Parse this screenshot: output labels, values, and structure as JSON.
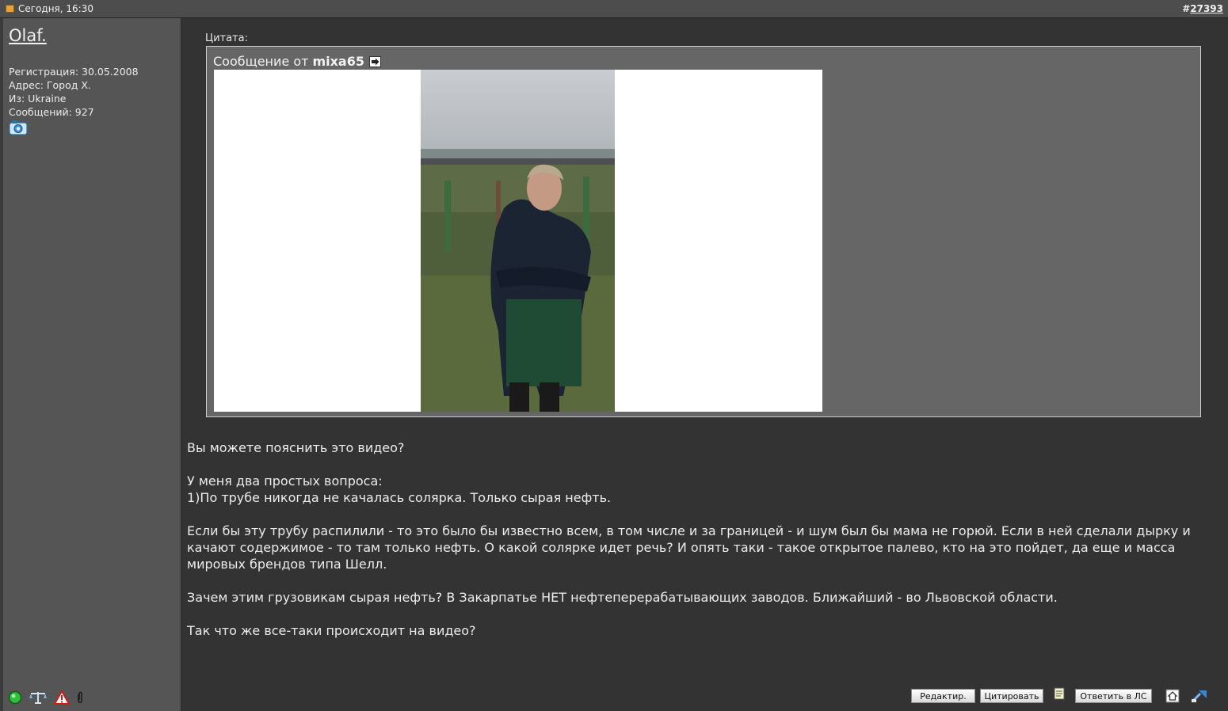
{
  "header": {
    "date": "Сегодня, 16:30",
    "post_hash": "#",
    "post_number": "27393"
  },
  "user": {
    "name": "Olaf.",
    "registration": "Регистрация: 30.05.2008",
    "address": "Адрес: Город Х.",
    "from": "Из: Ukraine",
    "posts": "Сообщений: 927"
  },
  "quote": {
    "label": "Цитата:",
    "prefix": "Сообщение от",
    "author": "mixa65"
  },
  "post": {
    "paragraphs": [
      "Вы можете пояснить это видео?",
      "У меня два простых вопроса:\n1)По трубе никогда не качалась солярка. Только сырая нефть.",
      "Если бы эту трубу распилили - то это было бы известно всем, в том числе и за границей - и шум был бы мама не горюй. Если в ней сделали дырку и качают содержимое - то там только нефть. О какой солярке идет речь? И опять таки - такое открытое палево, кто на это пойдет, да еще и масса мировых брендов типа Шелл.",
      "Зачем этим грузовикам сырая нефть? В Закарпатье НЕТ нефтеперерабатывающих заводов. Ближайший - во Львовской области.",
      "Так что же все-таки происходит на видео?"
    ]
  },
  "actions": {
    "edit": "Редактир.",
    "quote": "Цитировать",
    "reply_pm": "Ответить в ЛС"
  },
  "icons": {
    "status": [
      "online-icon",
      "scales-icon",
      "warning-icon",
      "paperclip-icon"
    ],
    "photo": "camera-icon",
    "goto": "arrow-right-icon"
  }
}
